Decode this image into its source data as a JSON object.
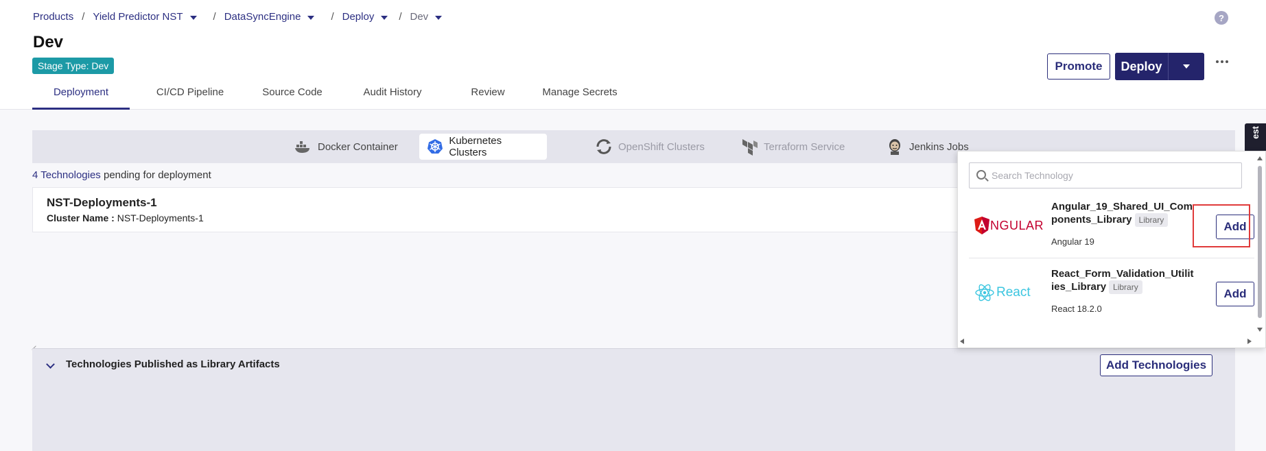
{
  "breadcrumb": {
    "items": [
      {
        "label": "Products",
        "has_caret": false
      },
      {
        "label": "Yield Predictor NST",
        "has_caret": true
      },
      {
        "label": "DataSyncEngine",
        "has_caret": true
      },
      {
        "label": "Deploy",
        "has_caret": true
      },
      {
        "label": "Dev",
        "has_caret": true
      }
    ],
    "separator": "/"
  },
  "help_icon": "?",
  "page": {
    "title": "Dev",
    "stage_badge": "Stage Type: Dev"
  },
  "actions": {
    "promote_label": "Promote",
    "deploy_label": "Deploy"
  },
  "tabs": [
    {
      "label": "Deployment",
      "active": true
    },
    {
      "label": "CI/CD Pipeline",
      "active": false
    },
    {
      "label": "Source Code",
      "active": false
    },
    {
      "label": "Audit History",
      "active": false
    },
    {
      "label": "Review",
      "active": false
    },
    {
      "label": "Manage Secrets",
      "active": false
    }
  ],
  "tech_tabs": [
    {
      "label": "Docker Container",
      "icon": "docker-icon",
      "state": "normal"
    },
    {
      "label": "Kubernetes Clusters",
      "icon": "kubernetes-icon",
      "state": "active"
    },
    {
      "label": "OpenShift Clusters",
      "icon": "openshift-icon",
      "state": "disabled"
    },
    {
      "label": "Terraform Service",
      "icon": "terraform-icon",
      "state": "disabled"
    },
    {
      "label": "Jenkins Jobs",
      "icon": "jenkins-icon",
      "state": "normal"
    }
  ],
  "pending": {
    "count_text": "4 Technologies",
    "suffix": "pending for deployment"
  },
  "cluster": {
    "name": "NST-Deployments-1",
    "label": "Cluster Name :",
    "value": "NST-Deployments-1"
  },
  "library_section": {
    "title": "Technologies Published as Library Artifacts",
    "add_label": "Add Technologies"
  },
  "side_tab_label": "est",
  "tech_picker": {
    "search_placeholder": "Search Technology",
    "items": [
      {
        "name": "Angular_19_Shared_UI_Components_Library",
        "badge": "Library",
        "version": "Angular 19",
        "logo": "angular-logo",
        "logo_text": "NGULAR",
        "add_label": "Add"
      },
      {
        "name": "React_Form_Validation_Utilities_Library",
        "badge": "Library",
        "version": "React 18.2.0",
        "logo": "react-logo",
        "logo_text": "React",
        "add_label": "Add"
      }
    ]
  },
  "colors": {
    "primary": "#24246b",
    "link": "#2c2f82",
    "badge_teal": "#1c9aa6",
    "highlight": "#e03a3a"
  }
}
